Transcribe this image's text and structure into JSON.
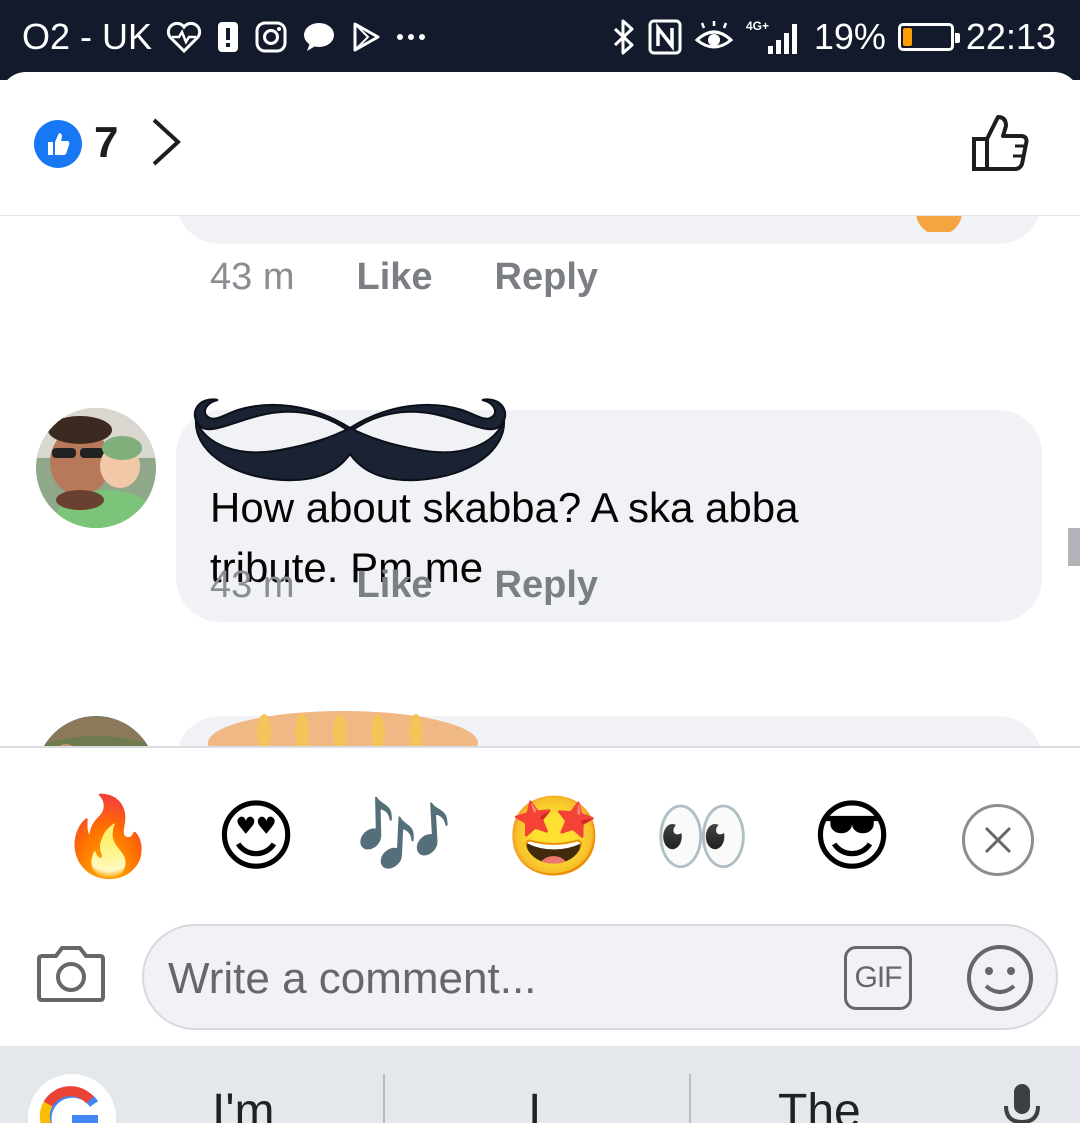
{
  "status_bar": {
    "carrier": "O2 - UK",
    "battery_percent": "19%",
    "battery_level": 0.19,
    "network": "4G+",
    "time": "22:13",
    "left_icons": [
      "heart-rate-icon",
      "notification-icon",
      "instagram-icon",
      "messenger-icon",
      "play-store-icon",
      "more-icon"
    ],
    "right_icons": [
      "bluetooth-icon",
      "nfc-icon",
      "eye-comfort-icon",
      "signal-icon",
      "battery-icon"
    ]
  },
  "reactions_header": {
    "like_count": "7",
    "icons": [
      "thumbs-up-badge-icon",
      "chevron-right-icon",
      "like-outline-icon"
    ]
  },
  "comments": [
    {
      "time": "43 m",
      "like_label": "Like",
      "reply_label": "Reply"
    },
    {
      "text_line1": "How about skabba? A ska abba",
      "text_line2": "tribute. Pm me",
      "time": "43 m",
      "like_label": "Like",
      "reply_label": "Reply"
    },
    {}
  ],
  "emoji_suggestions": [
    "🔥",
    "😍",
    "🎶",
    "🤩",
    "👀",
    "😎"
  ],
  "composer": {
    "placeholder": "Write a comment...",
    "gif_label": "GIF"
  },
  "keyboard": {
    "suggestions": [
      "I'm",
      "I",
      "The"
    ]
  },
  "colors": {
    "status_bar_bg": "#121a2b",
    "like_blue": "#1877f2",
    "bubble_bg": "#f0f2f5",
    "muted_text": "#8a8d91",
    "battery_orange": "#ff9c00"
  }
}
